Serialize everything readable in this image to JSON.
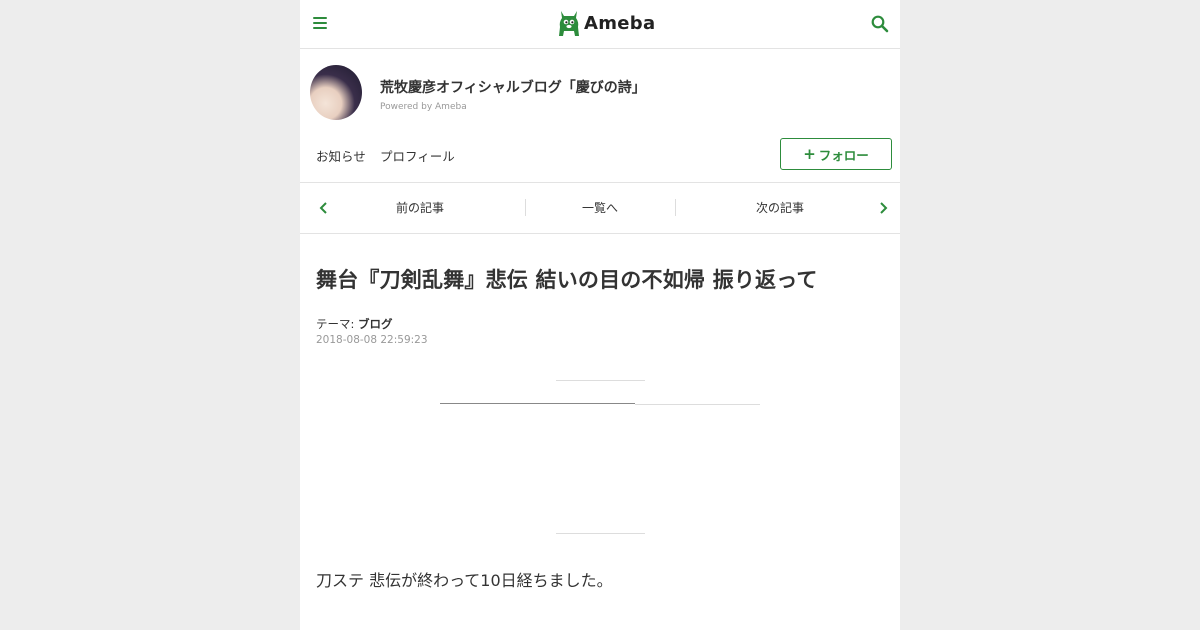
{
  "header": {
    "logo_text": "Ameba",
    "brand_color": "#2d8c3c"
  },
  "blog": {
    "title": "荒牧慶彦オフィシャルブログ「慶びの詩」",
    "powered_by": "Powered by Ameba",
    "nav": {
      "news": "お知らせ",
      "profile": "プロフィール"
    },
    "follow_label": "フォロー"
  },
  "pager": {
    "prev": "前の記事",
    "list": "一覧へ",
    "next": "次の記事"
  },
  "article": {
    "title": "舞台『刀剣乱舞』悲伝 結いの目の不如帰 振り返って",
    "theme_label": "テーマ:",
    "theme_value": "ブログ",
    "date": "2018-08-08 22:59:23",
    "body": "刀ステ 悲伝が終わって10日経ちました。"
  }
}
